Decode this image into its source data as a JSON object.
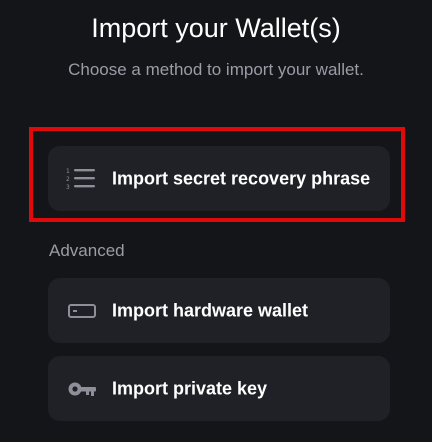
{
  "header": {
    "title": "Import your Wallet(s)",
    "subtitle": "Choose a method to import your wallet."
  },
  "options": [
    {
      "label": "Import secret recovery phrase",
      "icon": "numbered-list-icon"
    },
    {
      "label": "Import hardware wallet",
      "icon": "hardware-wallet-icon"
    },
    {
      "label": "Import private key",
      "icon": "key-icon"
    }
  ],
  "section": {
    "advanced_label": "Advanced"
  },
  "colors": {
    "background": "#141519",
    "card": "#202127",
    "highlight_border": "#e10a0a",
    "text_primary": "#ffffff",
    "text_secondary": "#9a9ca6",
    "icon": "#8e9099"
  }
}
